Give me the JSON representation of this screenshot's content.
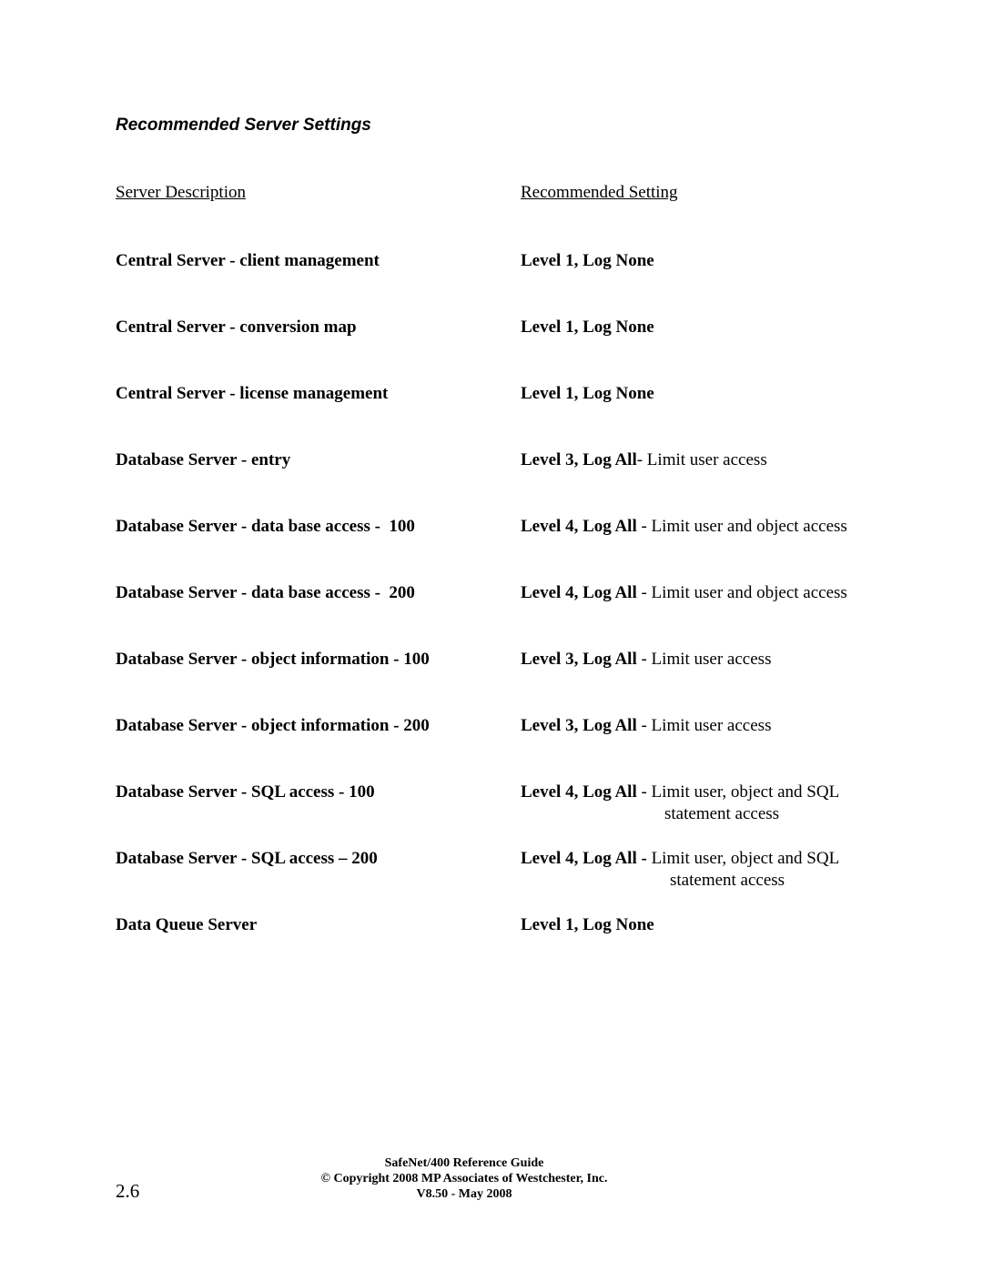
{
  "page": {
    "title": "Recommended Server Settings",
    "headers": {
      "description": "Server Description",
      "setting": "Recommended Setting"
    },
    "rows": [
      {
        "description": "Central Server - client management",
        "setting_bold": "Level 1, Log None",
        "setting_rest": "",
        "continuation": ""
      },
      {
        "description": "Central Server - conversion map",
        "setting_bold": "Level 1, Log None",
        "setting_rest": "",
        "continuation": ""
      },
      {
        "description": "Central Server - license management",
        "setting_bold": "Level 1, Log None",
        "setting_rest": "",
        "continuation": ""
      },
      {
        "description": "Database Server - entry",
        "setting_bold": "Level 3, Log All",
        "setting_rest": "- Limit user access",
        "continuation": ""
      },
      {
        "description": "Database Server - data base access -  100",
        "setting_bold": "Level 4, Log All",
        "setting_rest": " - Limit user and object access",
        "continuation": ""
      },
      {
        "description": "Database Server - data base access -  200",
        "setting_bold": "Level 4, Log All",
        "setting_rest": " - Limit user and object access",
        "continuation": ""
      },
      {
        "description": "Database Server - object information - 100",
        "setting_bold": "Level 3, Log All",
        "setting_rest": " - Limit user access",
        "continuation": ""
      },
      {
        "description": "Database Server - object information - 200",
        "setting_bold": "Level 3, Log All",
        "setting_rest": " - Limit user access",
        "continuation": ""
      },
      {
        "description": "Database Server - SQL access - 100",
        "setting_bold": "Level 4, Log All",
        "setting_rest": " - Limit user, object and SQL",
        "continuation": "statement access"
      },
      {
        "description": "Database Server - SQL access – 200",
        "setting_bold": "Level 4, Log All -",
        "setting_rest": " Limit user, object and SQL",
        "continuation": "statement access"
      },
      {
        "description": "Data Queue Server",
        "setting_bold": "Level 1, Log None",
        "setting_rest": "",
        "continuation": ""
      }
    ]
  },
  "footer": {
    "page_number": "2.6",
    "line1": "SafeNet/400 Reference Guide",
    "line2": "© Copyright 2008 MP Associates of Westchester, Inc.",
    "line3": "V8.50  - May 2008"
  }
}
